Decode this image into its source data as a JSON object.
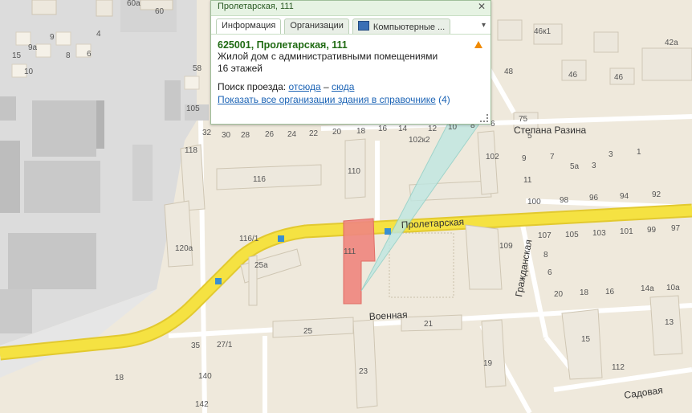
{
  "popup": {
    "title": "Пролетарская, 111",
    "close_glyph": "✕",
    "tabs": [
      {
        "label": "Информация"
      },
      {
        "label": "Организации"
      },
      {
        "label": "Компьютерные ..."
      }
    ],
    "tabs_menu_glyph": "▾",
    "address": "625001, Пролетарская, 111",
    "building_type": "Жилой дом с административными помещениями",
    "floors": "16 этажей",
    "route_label": "Поиск проезда:",
    "route_from": "отсюда",
    "route_sep": "–",
    "route_to": "сюда",
    "show_all": "Показать все организации здания в справочнике",
    "org_count": "(4)",
    "warn_icon": "warning-icon",
    "tab_icon": "monitor-icon"
  },
  "map": {
    "streets": [
      "Пролетарская",
      "Военная",
      "Гражданская",
      "Степана Разина",
      "Садовая"
    ],
    "numbers": [
      "4",
      "60",
      "60а",
      "46к1",
      "42а",
      "48",
      "46",
      "46",
      "10",
      "58",
      "6",
      "8",
      "9а",
      "15",
      "9",
      "105",
      "118",
      "32",
      "30",
      "28",
      "26",
      "24",
      "22",
      "20",
      "18",
      "16",
      "14",
      "12",
      "10",
      "8",
      "6",
      "102к2",
      "75",
      "102",
      "5",
      "7",
      "3",
      "1",
      "9",
      "5а",
      "3",
      "11",
      "110",
      "116",
      "100",
      "98",
      "96",
      "94",
      "92",
      "120а",
      "116/1",
      "25а",
      "111",
      "109",
      "107",
      "105",
      "103",
      "101",
      "99",
      "97",
      "8",
      "6",
      "20",
      "18",
      "16",
      "14а",
      "10а",
      "25",
      "21",
      "13",
      "35",
      "27/1",
      "15",
      "19",
      "23",
      "112",
      "18",
      "140",
      "142"
    ]
  },
  "colors": {
    "main_road": "#f5e242",
    "road_outline": "#e2c92f",
    "building": "#ece7dc",
    "building_roof": "#e4dfd3",
    "industrial": "#d6d6d6",
    "highlight": "#f07a73",
    "popup_border": "#9fbf9a",
    "address_green": "#1f6a12",
    "link_blue": "#1b63b5"
  }
}
